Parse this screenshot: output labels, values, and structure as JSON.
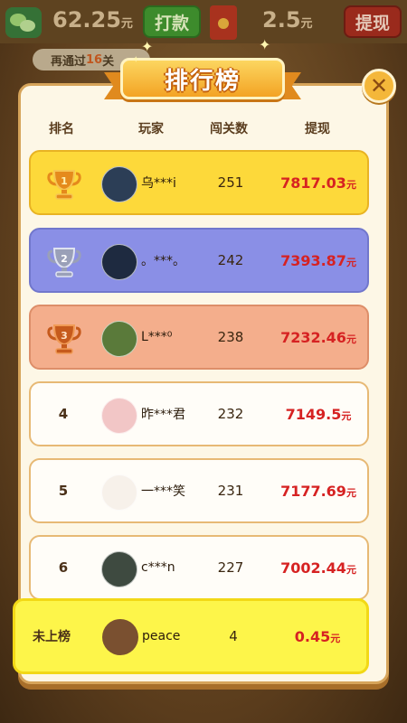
{
  "topbar": {
    "balance1": "62.25",
    "balance1_unit": "元",
    "dakuan_label": "打款",
    "balance2": "2.5",
    "balance2_unit": "元",
    "tixian_label": "提现",
    "progress_prefix": "再通过",
    "progress_num": "16",
    "progress_suffix": "关"
  },
  "title": "排行榜",
  "headers": {
    "rank": "排名",
    "player": "玩家",
    "levels": "闯关数",
    "withdraw": "提现"
  },
  "rows": [
    {
      "rank": "1",
      "name": "乌***i",
      "levels": "251",
      "amount": "7817.03",
      "unit": "元",
      "avatar_color": "#2c3e56"
    },
    {
      "rank": "2",
      "name": "。***。",
      "levels": "242",
      "amount": "7393.87",
      "unit": "元",
      "avatar_color": "#1e2a40"
    },
    {
      "rank": "3",
      "name": "L***⁰",
      "levels": "238",
      "amount": "7232.46",
      "unit": "元",
      "avatar_color": "#5a7a3a"
    },
    {
      "rank": "4",
      "name": "昨***君",
      "levels": "232",
      "amount": "7149.5",
      "unit": "元",
      "avatar_color": "#f2c6c6"
    },
    {
      "rank": "5",
      "name": "一***笑",
      "levels": "231",
      "amount": "7177.69",
      "unit": "元",
      "avatar_color": "#f7f1ea"
    },
    {
      "rank": "6",
      "name": "c***n",
      "levels": "227",
      "amount": "7002.44",
      "unit": "元",
      "avatar_color": "#3e4a40"
    }
  ],
  "mine": {
    "rank": "未上榜",
    "name": "peace",
    "levels": "4",
    "amount": "0.45",
    "unit": "元",
    "avatar_color": "#7a5030"
  },
  "colors": {
    "gold": "#fdd93a",
    "silver": "#8a8fe6",
    "bronze": "#f4ae8c",
    "amount": "#d62222",
    "ribbon": "#f3a324"
  },
  "icons": {
    "close": "close-icon",
    "trophy": "trophy-icon",
    "wechat": "wechat-icon",
    "redpacket": "red-packet-icon"
  }
}
